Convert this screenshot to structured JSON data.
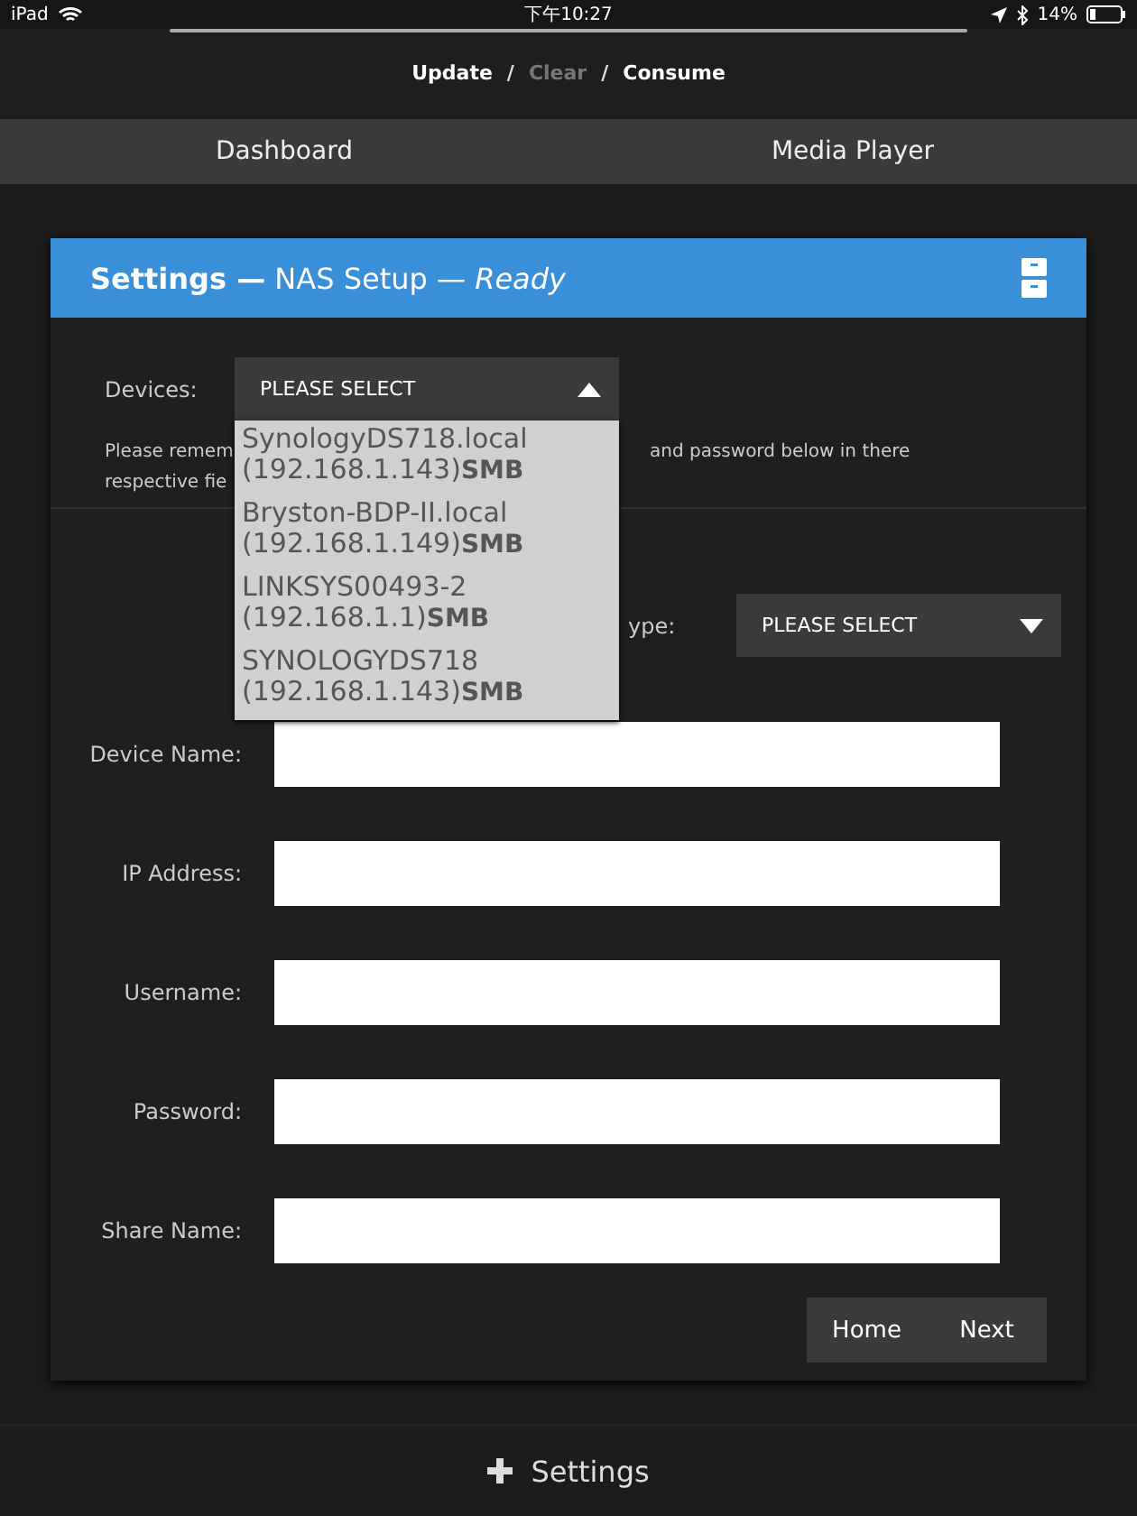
{
  "status_bar": {
    "device": "iPad",
    "time": "下午10:27",
    "battery": "14%"
  },
  "actions": [
    {
      "label": "Update",
      "disabled": false
    },
    {
      "label": "Clear",
      "disabled": true
    },
    {
      "label": "Consume",
      "disabled": false
    }
  ],
  "action_separator": "/",
  "nav": [
    {
      "label": "Dashboard"
    },
    {
      "label": "Media Player"
    }
  ],
  "card": {
    "title": "Settings —",
    "subtitle": "NAS Setup —",
    "state": "Ready"
  },
  "devices": {
    "label": "Devices:",
    "value": "PLEASE SELECT",
    "expanded": true,
    "options": [
      {
        "name": "SynologyDS718.local",
        "address": "(192.168.1.143)",
        "protocol": "SMB"
      },
      {
        "name": "Bryston-BDP-II.local",
        "address": "(192.168.1.149)",
        "protocol": "SMB"
      },
      {
        "name": "LINKSYS00493-2",
        "address": "(192.168.1.1)",
        "protocol": "SMB"
      },
      {
        "name": "SYNOLOGYDS718",
        "address": "(192.168.1.143)",
        "protocol": "SMB"
      }
    ]
  },
  "note": {
    "line_1_left": "Please remem",
    "line_1_right": "and password below in there",
    "line_2_left": "respective fie"
  },
  "type_select": {
    "label": "ype:",
    "value": "PLEASE SELECT",
    "expanded": false
  },
  "fields": [
    {
      "label": "Device Name:"
    },
    {
      "label": "IP Address:"
    },
    {
      "label": "Username:"
    },
    {
      "label": "Password:"
    },
    {
      "label": "Share Name:"
    }
  ],
  "buttons": [
    "Home",
    "Next"
  ],
  "footer": {
    "label": "Settings"
  }
}
